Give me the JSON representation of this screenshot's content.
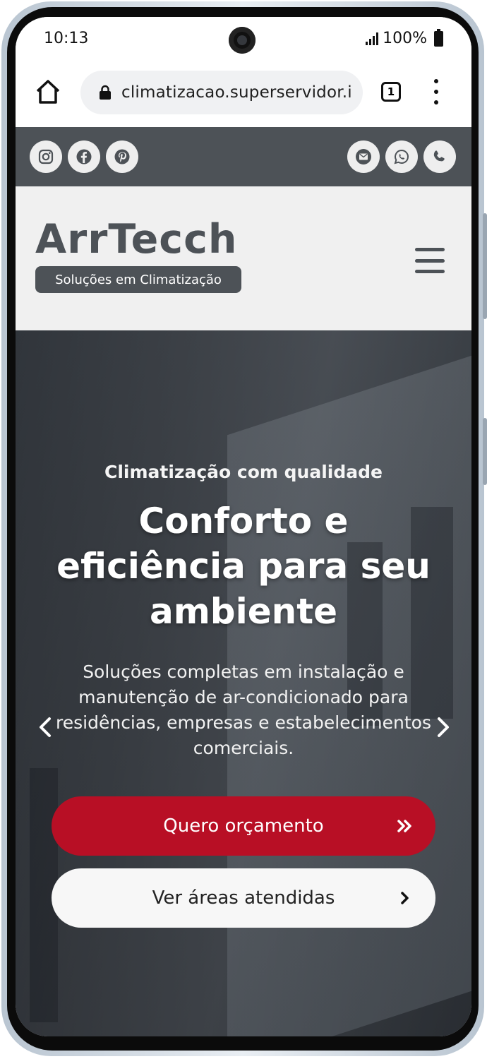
{
  "status_bar": {
    "time": "10:13",
    "battery": "100%"
  },
  "browser": {
    "url": "climatizacao.superservidor.i",
    "tab_count": "1"
  },
  "top_bar": {
    "social_icons": [
      "instagram-icon",
      "facebook-icon",
      "pinterest-icon"
    ],
    "contact_icons": [
      "email-icon",
      "whatsapp-icon",
      "phone-icon"
    ]
  },
  "header": {
    "logo": "ArrTecch",
    "tagline": "Soluções em Climatização"
  },
  "hero": {
    "subtitle": "Climatização com qualidade",
    "title": "Conforto e eficiência para seu ambiente",
    "description": "Soluções completas em instalação e manutenção de ar-condicionado para residências, empresas e estabelecimentos comerciais.",
    "primary_button": "Quero orçamento",
    "secondary_button": "Ver áreas atendidas"
  },
  "colors": {
    "brand_gray": "#4d5257",
    "accent_red": "#b80f25",
    "header_bg": "#f0f0f0"
  }
}
